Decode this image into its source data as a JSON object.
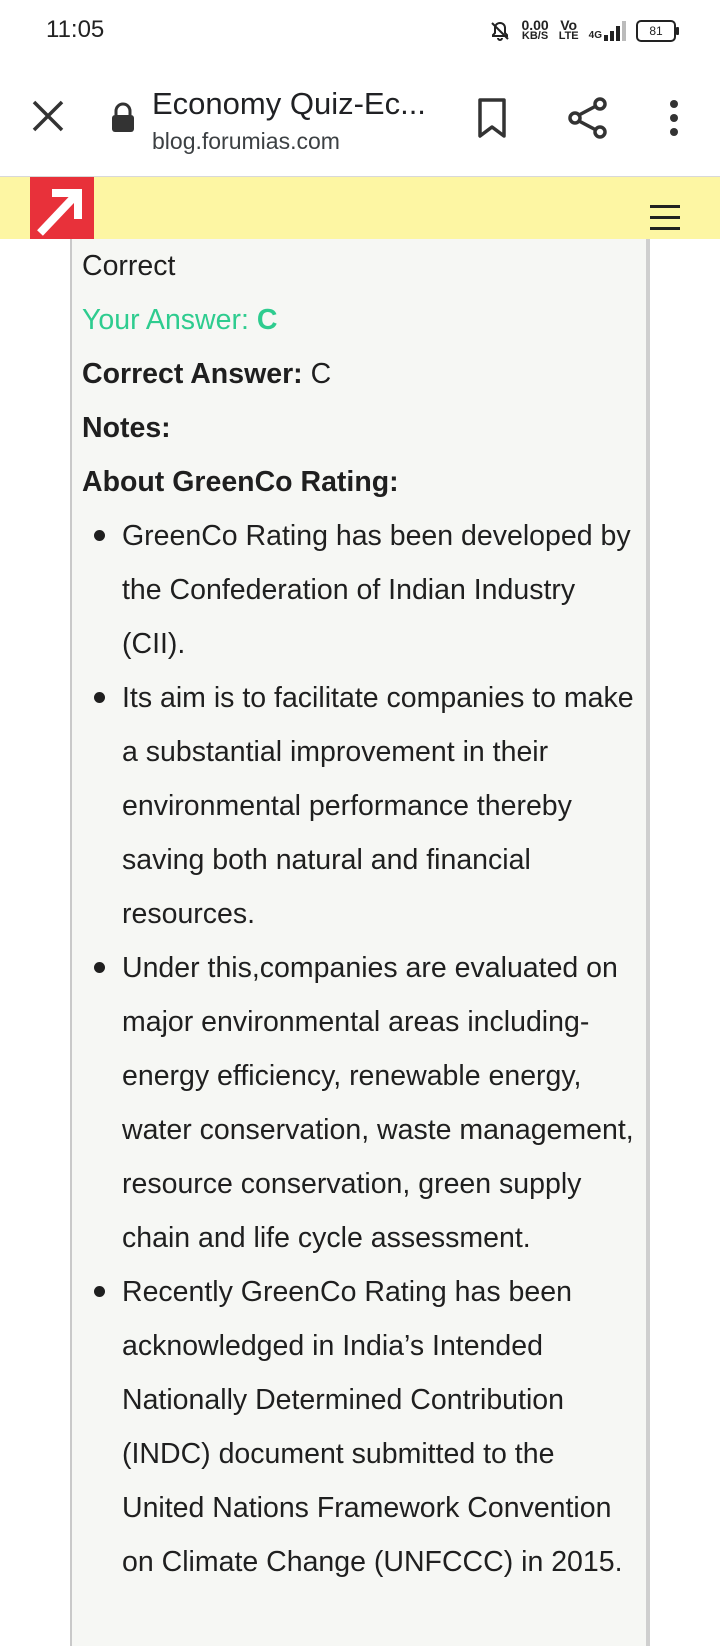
{
  "status_bar": {
    "time": "11:05",
    "net_speed_value": "0.00",
    "net_speed_unit": "KB/S",
    "volte_top": "Vo",
    "volte_bottom": "LTE",
    "network": "4G",
    "battery": "81"
  },
  "toolbar": {
    "title": "Economy Quiz-Ec...",
    "url": "blog.forumias.com",
    "icons": [
      "close-icon",
      "lock-icon",
      "bookmark-icon",
      "share-icon",
      "more-vert-icon"
    ]
  },
  "site_header": {
    "logo_icon": "arrow-up-right-logo",
    "menu_icon": "hamburger-icon",
    "background": "#fdf6a3",
    "logo_color": "#e8313a"
  },
  "quiz_result": {
    "status": "Correct",
    "your_answer_label": "Your Answer:",
    "your_answer_value": "C",
    "correct_answer_label": "Correct Answer:",
    "correct_answer_value": "C",
    "notes_label": "Notes:",
    "section_heading": "About GreenCo Rating:",
    "accent_color": "#2ecc8f",
    "notes": [
      "GreenCo Rating has been developed by the Confederation of Indian Industry (CII).",
      "Its aim is to facilitate companies to make a substantial improvement in their environmental performance thereby saving both natural and financial resources.",
      "Under this,companies are evaluated on major environmental areas including- energy efficiency, renewable energy, water conservation, waste management, resource conservation, green supply chain and life cycle assessment.",
      "Recently GreenCo Rating has been acknowledged in India’s Intended Nationally Determined Contribution (INDC) document submitted to the United Nations Framework Convention on Climate Change (UNFCCC) in 2015."
    ]
  }
}
